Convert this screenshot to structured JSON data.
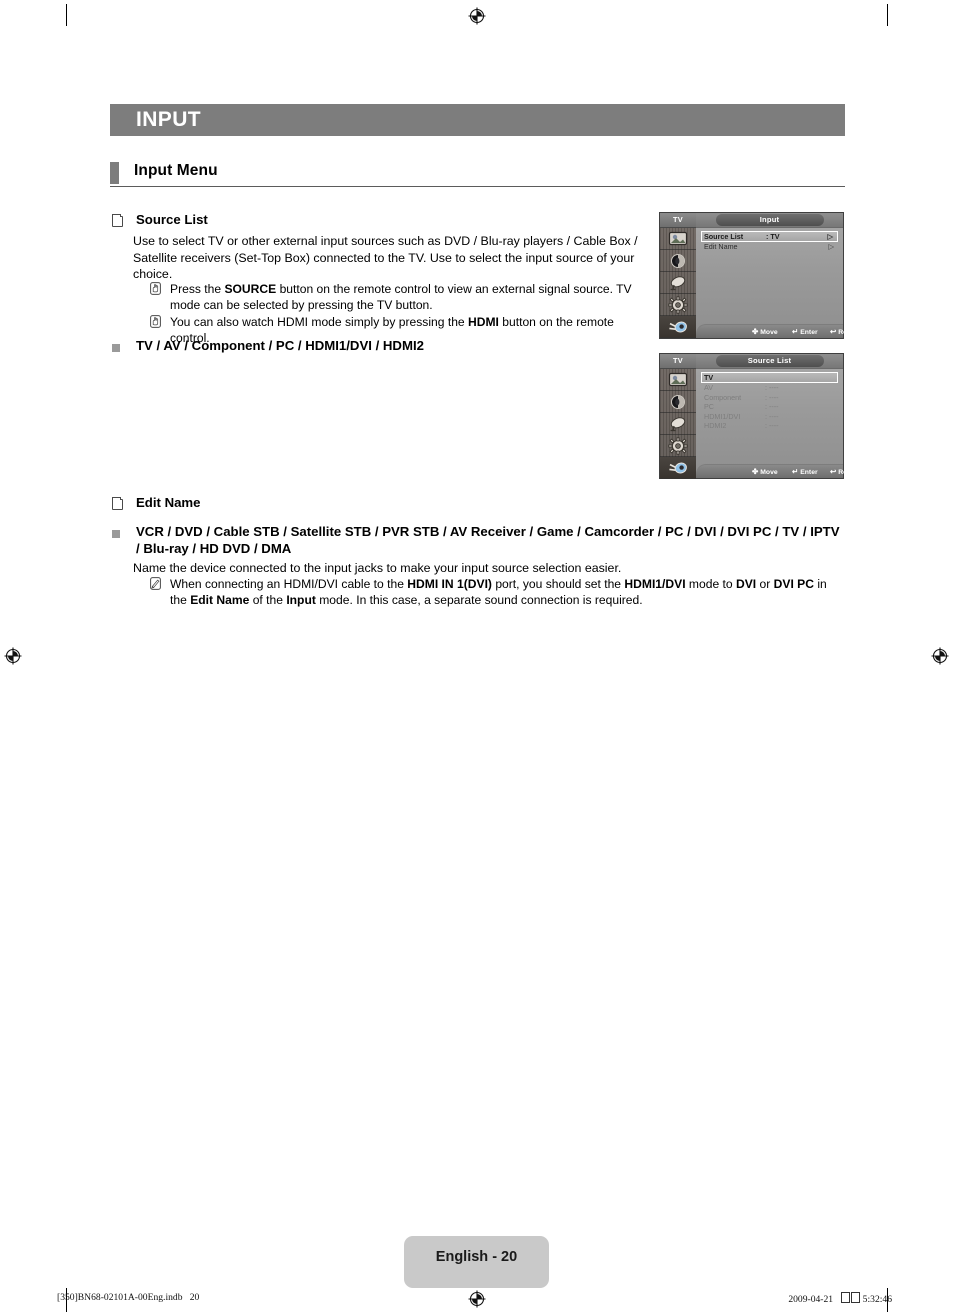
{
  "document": {
    "chapter_title": "INPUT",
    "section_title": "Input Menu",
    "page_label": "English - 20"
  },
  "source_list": {
    "heading": "Source List",
    "paragraph": "Use to select TV or other external input sources such as DVD / Blu-ray players / Cable Box / Satellite receivers (Set-Top Box) connected to the TV. Use to select the input source of your choice.",
    "notes": [
      {
        "icon": "remote-note-icon",
        "segments": [
          {
            "t": "Press the ",
            "b": false
          },
          {
            "t": "SOURCE",
            "b": true
          },
          {
            "t": " button on the remote control to view an external signal source. TV mode can be selected by pressing the TV button.",
            "b": false
          }
        ]
      },
      {
        "icon": "remote-note-icon",
        "segments": [
          {
            "t": "You can also watch HDMI mode simply by pressing the ",
            "b": false
          },
          {
            "t": "HDMI",
            "b": true
          },
          {
            "t": " button on the remote control.",
            "b": false
          }
        ]
      }
    ],
    "options_line": "TV / AV / Component / PC / HDMI1/DVI / HDMI2"
  },
  "edit_name": {
    "heading": "Edit Name",
    "options_line": "VCR / DVD / Cable STB / Satellite STB / PVR STB / AV Receiver / Game / Camcorder / PC / DVI / DVI PC / TV / IPTV / Blu-ray / HD DVD / DMA",
    "paragraph": "Name the device connected to the input jacks to make your input source selection easier.",
    "notes": [
      {
        "icon": "pencil-note-icon",
        "segments": [
          {
            "t": "When connecting an HDMI/DVI cable to the ",
            "b": false
          },
          {
            "t": "HDMI IN 1(DVI)",
            "b": true
          },
          {
            "t": " port, you should set the ",
            "b": false
          },
          {
            "t": "HDMI1/DVI",
            "b": true
          },
          {
            "t": " mode to ",
            "b": false
          },
          {
            "t": "DVI",
            "b": true
          },
          {
            "t": " or ",
            "b": false
          },
          {
            "t": "DVI PC",
            "b": true
          },
          {
            "t": " in the ",
            "b": false
          },
          {
            "t": "Edit Name",
            "b": true
          },
          {
            "t": " of the ",
            "b": false
          },
          {
            "t": "Input",
            "b": true
          },
          {
            "t": " mode. In this case, a separate sound connection is required.",
            "b": false
          }
        ]
      }
    ]
  },
  "osd_menus": [
    {
      "id": "input-menu",
      "sidebar_label": "TV",
      "sidebar_icons": [
        "picture-icon",
        "sound-icon",
        "channel-icon",
        "setup-icon",
        "input-icon"
      ],
      "sidebar_active_index": 4,
      "title": "Input",
      "rows": [
        {
          "label": "Source List",
          "value": ": TV",
          "arrow": "▷",
          "selected": true,
          "dim": false
        },
        {
          "label": "Edit Name",
          "value": "",
          "arrow": "▷",
          "selected": false,
          "dim": false
        }
      ],
      "footer": [
        {
          "glyph": "✤",
          "label": "Move"
        },
        {
          "glyph": "↵",
          "label": "Enter"
        },
        {
          "glyph": "↩",
          "label": "Return"
        }
      ]
    },
    {
      "id": "source-list-menu",
      "sidebar_label": "TV",
      "sidebar_icons": [
        "picture-icon",
        "sound-icon",
        "channel-icon",
        "setup-icon",
        "input-icon"
      ],
      "sidebar_active_index": 4,
      "title": "Source List",
      "rows": [
        {
          "label": "TV",
          "value": "",
          "arrow": "",
          "selected": true,
          "dim": false
        },
        {
          "label": "AV",
          "value": ": ----",
          "arrow": "",
          "selected": false,
          "dim": true
        },
        {
          "label": "Component",
          "value": ": ----",
          "arrow": "",
          "selected": false,
          "dim": true
        },
        {
          "label": "PC",
          "value": ": ----",
          "arrow": "",
          "selected": false,
          "dim": true
        },
        {
          "label": "HDMI1/DVI",
          "value": ": ----",
          "arrow": "",
          "selected": false,
          "dim": true
        },
        {
          "label": "HDMI2",
          "value": ": ----",
          "arrow": "",
          "selected": false,
          "dim": true
        }
      ],
      "footer": [
        {
          "glyph": "✤",
          "label": "Move"
        },
        {
          "glyph": "↵",
          "label": "Enter"
        },
        {
          "glyph": "↩",
          "label": "Return"
        }
      ]
    }
  ],
  "print_footer": {
    "left": "[350]BN68-02101A-00Eng.indb   20",
    "date": "2009-04-21",
    "time": "5:32:46",
    "tofu_count": 2
  }
}
